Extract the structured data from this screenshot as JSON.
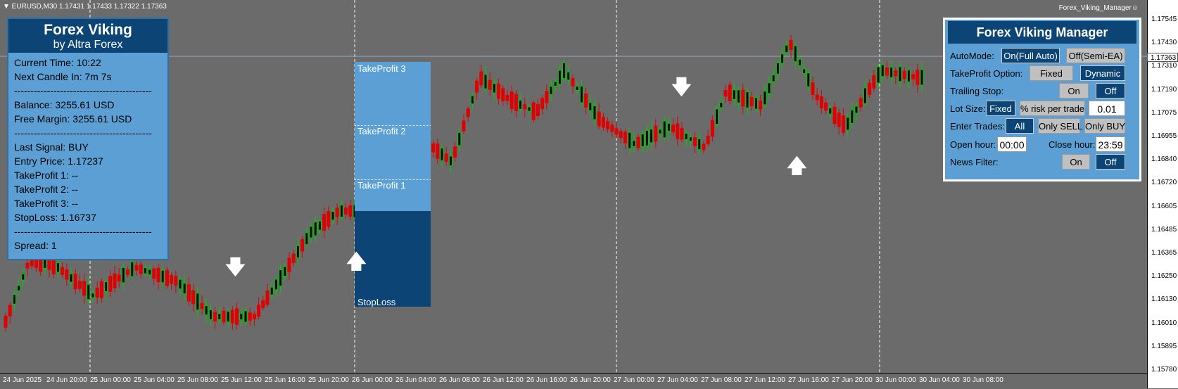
{
  "chart_header": {
    "symbol_line": "▼ EURUSD,M30  1.17431 1.17433 1.17322 1.17363",
    "indicator_name": "Forex_Viking_Manager☺",
    "current_price": "1.17363"
  },
  "price_axis": [
    "1.17545",
    "1.17430",
    "1.17310",
    "1.17190",
    "1.17075",
    "1.16955",
    "1.16840",
    "1.16720",
    "1.16605",
    "1.16485",
    "1.16365",
    "1.16250",
    "1.16130",
    "1.16010",
    "1.15895",
    "1.15780"
  ],
  "time_axis": [
    "24 Jun 2025",
    "24 Jun 20:00",
    "25 Jun 00:00",
    "25 Jun 04:00",
    "25 Jun 08:00",
    "25 Jun 12:00",
    "25 Jun 16:00",
    "25 Jun 20:00",
    "26 Jun 00:00",
    "26 Jun 04:00",
    "26 Jun 08:00",
    "26 Jun 12:00",
    "26 Jun 16:00",
    "26 Jun 20:00",
    "27 Jun 00:00",
    "27 Jun 04:00",
    "27 Jun 08:00",
    "27 Jun 12:00",
    "27 Jun 16:00",
    "27 Jun 20:00",
    "30 Jun 00:00",
    "30 Jun 04:00",
    "30 Jun 08:00"
  ],
  "info_panel": {
    "title": "Forex Viking",
    "subtitle": "by Altra Forex",
    "lines": [
      "Current Time: 10:22",
      "Next Candle In: 7m 7s",
      "------------------------------------------",
      "Balance: 3255.61 USD",
      "Free Margin: 3255.61 USD",
      "------------------------------------------",
      "Last Signal: BUY",
      "Entry Price: 1.17237",
      "TakeProfit 1: --",
      "TakeProfit 2: --",
      "TakeProfit 3: --",
      "StopLoss: 1.16737",
      "------------------------------------------",
      "Spread: 1"
    ]
  },
  "zones": {
    "tp3": "TakeProfit 3",
    "tp2": "TakeProfit 2",
    "tp1": "TakeProfit 1",
    "sl": "StopLoss"
  },
  "manager": {
    "title": "Forex Viking Manager",
    "automode_label": "AutoMode:",
    "automode_on": "On(Full Auto)",
    "automode_off": "Off(Semi-EA)",
    "tp_option_label": "TakeProfit Option:",
    "tp_fixed": "Fixed",
    "tp_dynamic": "Dynamic",
    "trailing_label": "Trailing Stop:",
    "trailing_on": "On",
    "trailing_off": "Off",
    "lot_label": "Lot Size:",
    "lot_fixed": "Fixed",
    "lot_risk": "% risk per trade",
    "lot_value": "0.01",
    "enter_label": "Enter Trades:",
    "enter_all": "All",
    "enter_sell": "Only SELL",
    "enter_buy": "Only BUY",
    "open_label": "Open hour:",
    "open_value": "00:00",
    "close_label": "Close hour:",
    "close_value": "23:59",
    "news_label": "News Filter:",
    "news_on": "On",
    "news_off": "Off"
  },
  "colors": {
    "bull_candle": "#00cc00",
    "bear_candle": "#e00000",
    "panel_bg": "#5b9fd4",
    "panel_header": "#0b4475"
  }
}
